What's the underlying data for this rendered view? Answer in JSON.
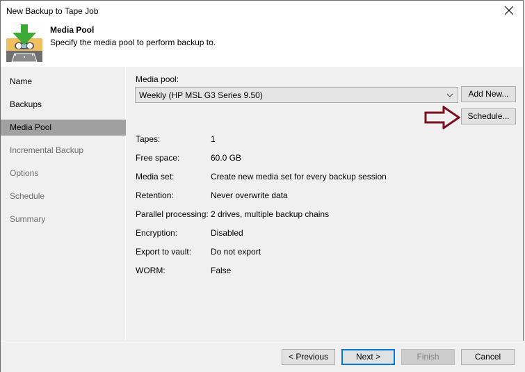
{
  "window": {
    "title": "New Backup to Tape Job",
    "close_icon": "close-icon"
  },
  "header": {
    "icon": "tape-cassette-download-icon",
    "title": "Media Pool",
    "subtitle": "Specify the media pool to perform backup to."
  },
  "sidebar": {
    "items": [
      {
        "label": "Name",
        "state": "done"
      },
      {
        "label": "Backups",
        "state": "done"
      },
      {
        "label": "Media Pool",
        "state": "active"
      },
      {
        "label": "Incremental Backup",
        "state": "pending"
      },
      {
        "label": "Options",
        "state": "pending"
      },
      {
        "label": "Schedule",
        "state": "pending"
      },
      {
        "label": "Summary",
        "state": "pending"
      }
    ]
  },
  "media_pool": {
    "label": "Media pool:",
    "selected": "Weekly (HP MSL G3 Series 9.50)",
    "add_new_label": "Add New...",
    "schedule_label": "Schedule...",
    "annotation_arrow_color": "#7b1020"
  },
  "properties": [
    {
      "label": "Tapes:",
      "value": "1"
    },
    {
      "label": "Free space:",
      "value": "60.0 GB"
    },
    {
      "label": "Media set:",
      "value": "Create new media set for every backup session"
    },
    {
      "label": "Retention:",
      "value": "Never overwrite data"
    },
    {
      "label": "Parallel processing:",
      "value": "2 drives, multiple backup chains"
    },
    {
      "label": "Encryption:",
      "value": "Disabled"
    },
    {
      "label": "Export to vault:",
      "value": "Do not export"
    },
    {
      "label": "WORM:",
      "value": "False"
    }
  ],
  "footer": {
    "previous_label": "< Previous",
    "next_label": "Next >",
    "finish_label": "Finish",
    "cancel_label": "Cancel"
  },
  "colors": {
    "active_nav_bg": "#a0a0a0",
    "primary_border": "#0078d7"
  }
}
